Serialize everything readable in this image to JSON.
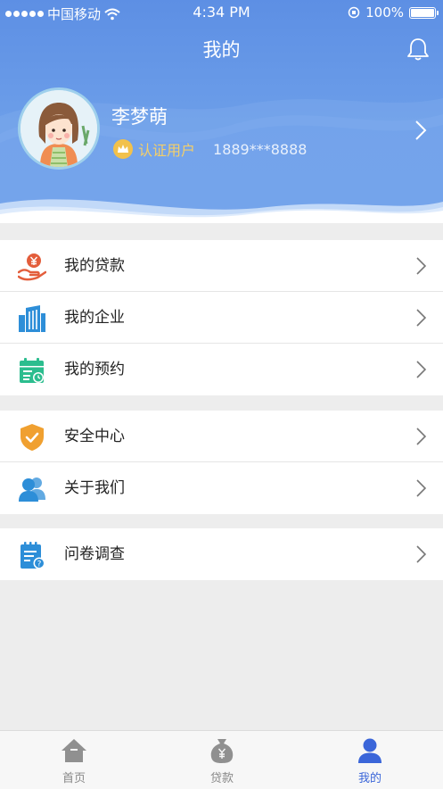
{
  "status_bar": {
    "carrier": "中国移动",
    "time": "4:34 PM",
    "battery": "100%"
  },
  "header": {
    "title": "我的"
  },
  "profile": {
    "name": "李梦萌",
    "badge": "认证用户",
    "phone": "1889***8888"
  },
  "menu_groups": [
    [
      {
        "label": "我的贷款",
        "icon": "loan-hand-icon"
      },
      {
        "label": "我的企业",
        "icon": "building-icon"
      },
      {
        "label": "我的预约",
        "icon": "calendar-icon"
      }
    ],
    [
      {
        "label": "安全中心",
        "icon": "shield-icon"
      },
      {
        "label": "关于我们",
        "icon": "users-icon"
      }
    ],
    [
      {
        "label": "问卷调查",
        "icon": "survey-icon"
      }
    ]
  ],
  "tabbar": {
    "items": [
      {
        "label": "首页",
        "icon": "home-icon",
        "active": false
      },
      {
        "label": "贷款",
        "icon": "money-bag-icon",
        "active": false
      },
      {
        "label": "我的",
        "icon": "person-icon",
        "active": true
      }
    ]
  },
  "colors": {
    "header_blue": "#6a9ce8",
    "active_tab": "#3b66d9",
    "badge_gold": "#f4cf69"
  }
}
